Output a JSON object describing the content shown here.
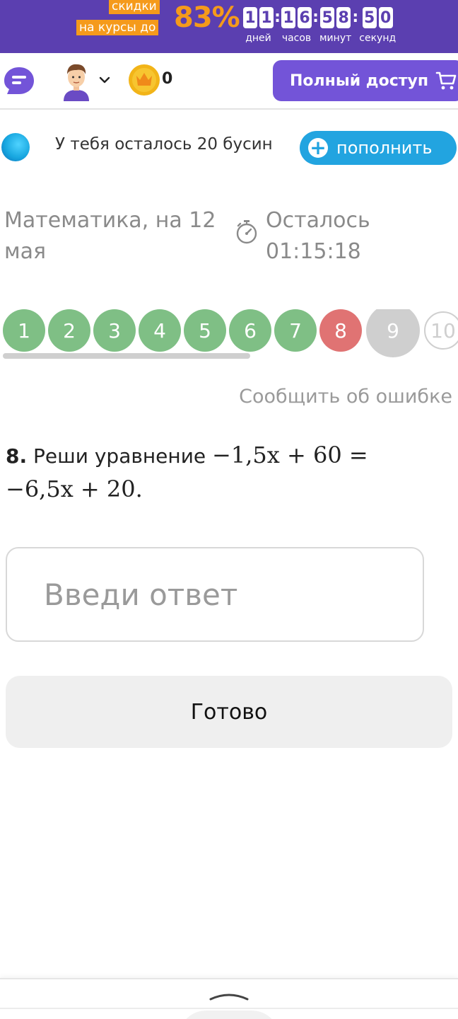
{
  "promo": {
    "line1": "скидки",
    "line2": "на курсы до",
    "percent": "83%",
    "countdown": [
      {
        "digits": [
          "1",
          "1"
        ],
        "label": "дней"
      },
      {
        "digits": [
          "1",
          "6"
        ],
        "label": "часов"
      },
      {
        "digits": [
          "5",
          "8"
        ],
        "label": "минут"
      },
      {
        "digits": [
          "5",
          "0"
        ],
        "label": "секунд"
      }
    ],
    "separator": ":"
  },
  "header": {
    "coin_count": "0",
    "full_access_label": "Полный доступ"
  },
  "beads": {
    "text": "У тебя осталось 20 бусин",
    "refill_label": "пополнить"
  },
  "test": {
    "title": "Математика, на 12 мая",
    "timer_label": "Осталось",
    "timer_value": "01:15:18"
  },
  "questions": [
    {
      "n": "1",
      "status": "done"
    },
    {
      "n": "2",
      "status": "done"
    },
    {
      "n": "3",
      "status": "done"
    },
    {
      "n": "4",
      "status": "done"
    },
    {
      "n": "5",
      "status": "done"
    },
    {
      "n": "6",
      "status": "done"
    },
    {
      "n": "7",
      "status": "done"
    },
    {
      "n": "8",
      "status": "wrong"
    },
    {
      "n": "9",
      "status": "current"
    },
    {
      "n": "10",
      "status": "todo"
    }
  ],
  "report_label": "Сообщить об ошибке",
  "question": {
    "number": "8.",
    "text": "Реши уравнение",
    "equation_line1": "−1,5x + 60 =",
    "equation_line2": "−6,5x + 20."
  },
  "answer": {
    "placeholder": "Введи ответ",
    "value": ""
  },
  "submit_label": "Готово",
  "colors": {
    "promo_bg": "#5b3fb0",
    "accent_orange": "#f59a1b",
    "full_access_bg": "#7354d8",
    "refill_bg": "#22a4e0",
    "done": "#7fbf85",
    "wrong": "#e07373",
    "current": "#cfcfcf"
  }
}
